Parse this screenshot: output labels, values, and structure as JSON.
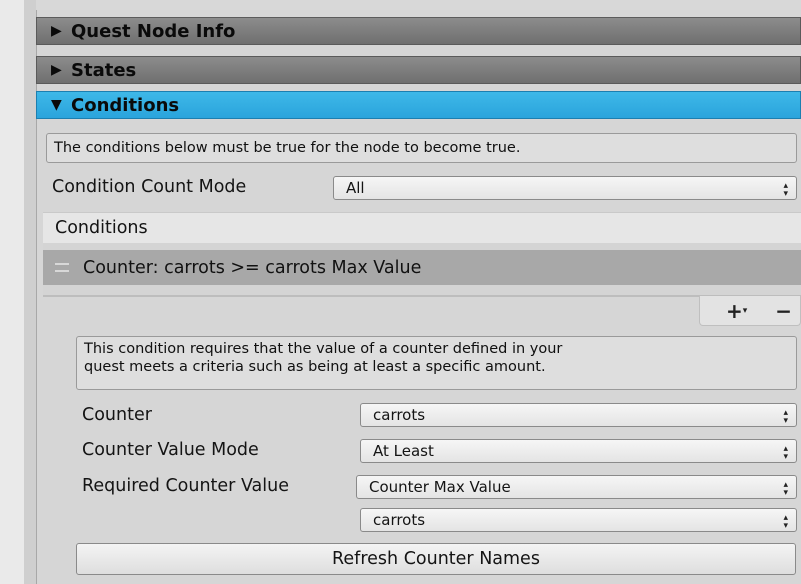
{
  "foldouts": {
    "quest_node_info": {
      "arrow": "▶",
      "label": "Quest Node Info"
    },
    "states": {
      "arrow": "▶",
      "label": "States"
    },
    "conditions": {
      "arrow": "▼",
      "label": "Conditions"
    }
  },
  "conditions_help": "The conditions below must be true for the node to become true.",
  "condition_count_mode": {
    "label": "Condition Count Mode",
    "value": "All"
  },
  "conditions_list": {
    "header": "Conditions",
    "element": "Counter: carrots >= carrots Max Value",
    "add_label": "+",
    "add_menu_indicator": "▾",
    "remove_label": "−"
  },
  "counter_condition": {
    "help_line1": "This condition requires that the value of a counter defined in your",
    "help_line2": "quest meets a criteria such as being at least a specific amount.",
    "counter_label": "Counter",
    "counter_value": "carrots",
    "value_mode_label": "Counter Value Mode",
    "value_mode_value": "At Least",
    "required_label": "Required Counter Value",
    "required_value": "Counter Max Value",
    "required_counter": "carrots",
    "refresh_button": "Refresh Counter Names"
  },
  "icons": {
    "popup_chevron": "updown-arrows-icon",
    "drag": "drag-handle-icon"
  },
  "colors": {
    "accent": "#34b0e4",
    "foldout": "#7a7a7a",
    "list_element": "#a8a8a8"
  }
}
